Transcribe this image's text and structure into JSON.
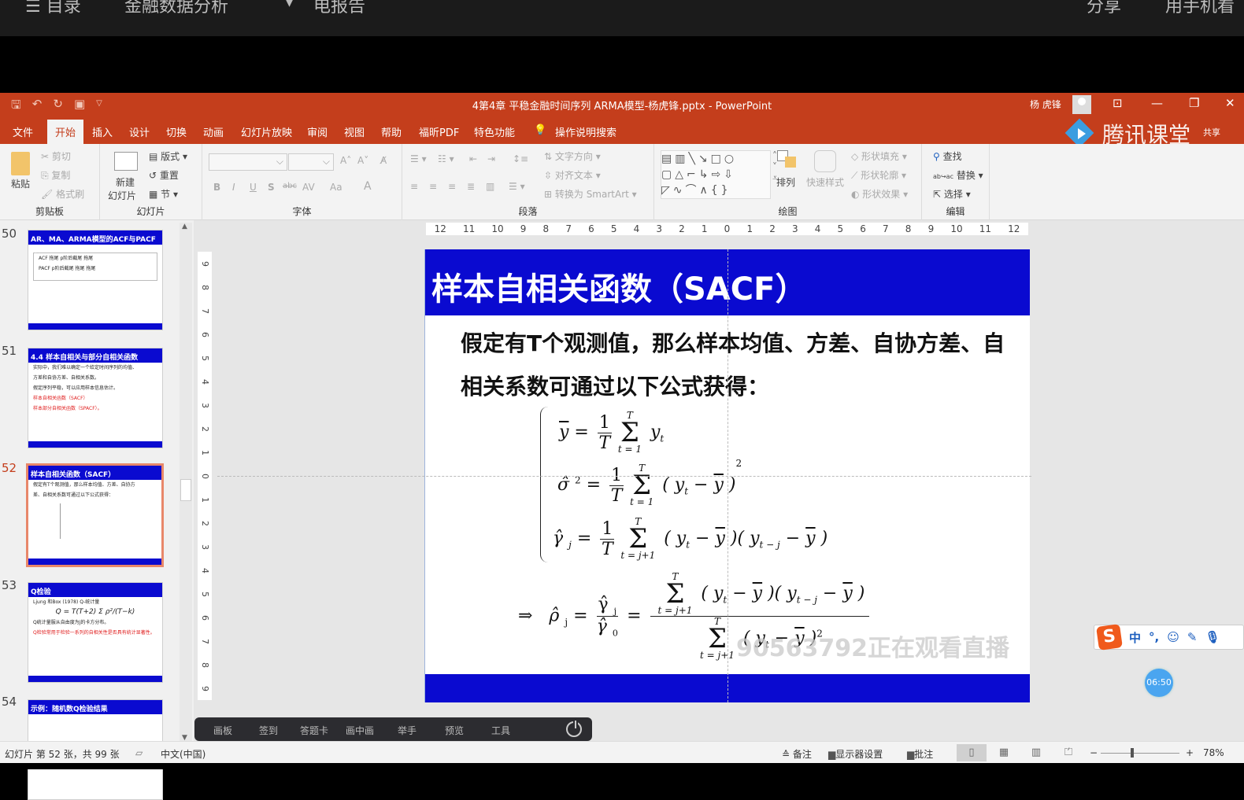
{
  "topbar": {
    "items": [
      "☰ 目录",
      "金融数据分析",
      "▾",
      "电报告"
    ],
    "right_items": [
      "分享",
      "用手机看"
    ]
  },
  "titlebar": {
    "doc_title": "4第4章 平稳金融时间序列 ARMA模型-杨虎锋.pptx  -  PowerPoint",
    "user_name": "杨 虎锋",
    "qat_icons": [
      "save-icon",
      "undo-icon",
      "redo-icon",
      "present-from-start-icon",
      "customize-qat-icon"
    ]
  },
  "tabs": [
    {
      "label": "文件"
    },
    {
      "label": "开始",
      "active": true
    },
    {
      "label": "插入"
    },
    {
      "label": "设计"
    },
    {
      "label": "切换"
    },
    {
      "label": "动画"
    },
    {
      "label": "幻灯片放映"
    },
    {
      "label": "审阅"
    },
    {
      "label": "视图"
    },
    {
      "label": "帮助"
    },
    {
      "label": "福昕PDF"
    },
    {
      "label": "特色功能"
    },
    {
      "label": "操作说明搜索"
    }
  ],
  "branding": {
    "name": "腾讯课堂",
    "share": "共享"
  },
  "ribbon": {
    "clipboard": {
      "label": "剪贴板",
      "paste": "粘贴",
      "cut": "剪切",
      "copy": "复制",
      "format_painter": "格式刷"
    },
    "slides": {
      "label": "幻灯片",
      "new_slide": "新建",
      "new_slide2": "幻灯片",
      "layout": "版式",
      "reset": "重置",
      "section": "节"
    },
    "font": {
      "label": "字体",
      "buttons": [
        "B",
        "I",
        "U",
        "S",
        "abc",
        "AV",
        "Aa",
        "A"
      ],
      "font_name": "",
      "font_size": ""
    },
    "paragraph": {
      "label": "段落",
      "text_direction": "文字方向",
      "align_text": "对齐文本",
      "convert_smartart": "转换为 SmartArt"
    },
    "drawing": {
      "label": "绘图",
      "arrange": "排列",
      "quick_styles": "快速样式",
      "shape_fill": "形状填充",
      "shape_outline": "形状轮廓",
      "shape_effects": "形状效果"
    },
    "editing": {
      "label": "编辑",
      "find": "查找",
      "replace": "替换",
      "select": "选择"
    }
  },
  "thumbnails": [
    {
      "num": "50",
      "title": "AR、MA、ARMA模型的ACF与PACF特征",
      "lines": [
        "ACF  拖尾  p阶后截尾  拖尾",
        "PACF  p阶后截尾  拖尾  拖尾"
      ]
    },
    {
      "num": "51",
      "title": "4.4 样本自相关与部分自相关函数",
      "lines": [
        "实际中，我们难以确定一个给定时间序列的均值、",
        "方差和自协方差、自相关系数。",
        "假定序列平稳，可以应用样本信息估计。"
      ],
      "red_lines": [
        "样本自相关函数（SACF）",
        "样本部分自相关函数（SPACF）。"
      ]
    },
    {
      "num": "52",
      "title": "样本自相关函数（SACF）",
      "lines": [
        "假定有T个观测值，那么样本均值、方差、自协方",
        "差、自相关系数可通过以下公式获得："
      ],
      "selected": true
    },
    {
      "num": "53",
      "title": "Q检验",
      "lines": [
        "Ljung 和Box (1978) Q-统计量",
        "Q = T(T+2) Σ ρ²/(T−k)",
        "Q统计量服从自由度为j的卡方分布。"
      ],
      "red_lines": [
        "Q检验常用于检验一系列的自相关性是否具有统计显著性。"
      ]
    },
    {
      "num": "54",
      "title": "示例：随机数Q检验结果",
      "lines": []
    }
  ],
  "rulers": {
    "horizontal": [
      "12",
      "11",
      "10",
      "9",
      "8",
      "7",
      "6",
      "5",
      "4",
      "3",
      "2",
      "1",
      "0",
      "1",
      "2",
      "3",
      "4",
      "5",
      "6",
      "7",
      "8",
      "9",
      "10",
      "11",
      "12"
    ],
    "vertical": [
      "9",
      "8",
      "7",
      "6",
      "5",
      "4",
      "3",
      "2",
      "1",
      "0",
      "1",
      "2",
      "3",
      "4",
      "5",
      "6",
      "7",
      "8",
      "9"
    ]
  },
  "slide": {
    "title": "样本自相关函数（SACF）",
    "body": "假定有T个观测值，那么样本均值、方差、自协方差、自相关系数可通过以下公式获得：",
    "formulas": {
      "mean": "ȳ = (1/T) Σ_{t=1}^{T} y_t",
      "variance": "σ̂² = (1/T) Σ_{t=1}^{T} (y_t − ȳ)²",
      "autocov": "γ̂_j = (1/T) Σ_{t=j+1}^{T} (y_t − ȳ)(y_{t−j} − ȳ)",
      "autocorr": "⇒ ρ̂_j = γ̂_j / γ̂_0 = Σ_{t=j+1}^{T}(y_t − ȳ)(y_{t−j} − ȳ) / Σ_{t=j+1}^{T}(y_t − ȳ)²"
    },
    "watermark": "90563792正在观看直播"
  },
  "classroom_bar": {
    "items": [
      "画板",
      "签到",
      "答题卡",
      "画中画",
      "举手",
      "预览",
      "工具"
    ]
  },
  "ime": {
    "mode": "中",
    "punct": "°,"
  },
  "timer": "06:50",
  "statusbar": {
    "slide_info": "幻灯片 第 52 张，共 99 张",
    "language": "中文(中国)",
    "notes": "备注",
    "display_settings": "显示器设置",
    "comments": "批注",
    "zoom": "78%",
    "zoom_minus": "−",
    "zoom_plus": "+"
  },
  "colors": {
    "accent": "#c43e1c",
    "slide_blue": "#0a0ad0"
  }
}
